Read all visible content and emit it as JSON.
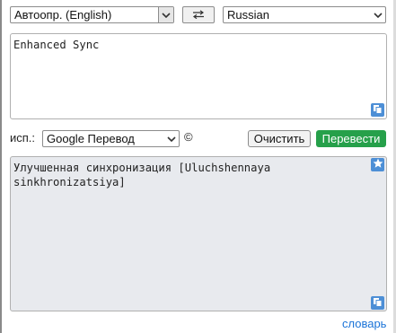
{
  "toolbar": {
    "source_language": "Автоопр. (English)",
    "target_language": "Russian"
  },
  "source": {
    "text": "Enhanced Sync"
  },
  "controls": {
    "use_label": "исп.:",
    "engine": "Google Перевод",
    "copyright": "©",
    "clear_label": "Очистить",
    "translate_label": "Перевести"
  },
  "result": {
    "text": "Улучшенная синхронизация [Uluchshennaya sinkhronizatsiya]"
  },
  "footer": {
    "dictionary_link": "словарь"
  },
  "icons": {
    "swap": "swap-arrows-icon",
    "copy": "copy-icon",
    "star": "star-icon",
    "dropdown": "chevron-down-icon"
  },
  "colors": {
    "accent_blue": "#4d8fd6",
    "translate_green": "#26a04a",
    "link_blue": "#1a73d8",
    "result_bg": "#e8eaee"
  }
}
